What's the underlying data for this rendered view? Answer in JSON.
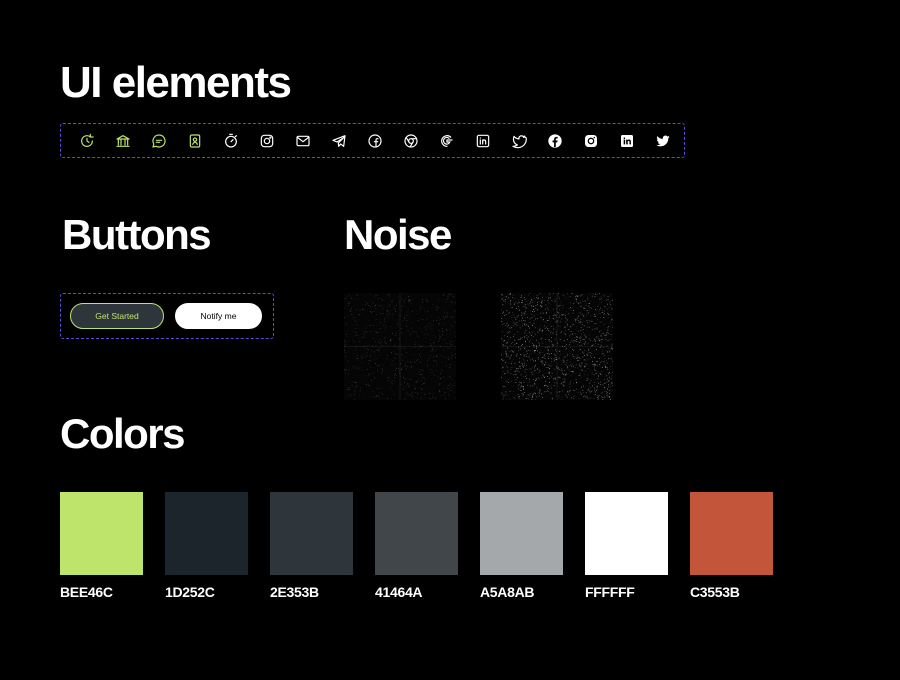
{
  "headings": {
    "ui_elements": "UI elements",
    "buttons": "Buttons",
    "noise": "Noise",
    "colors": "Colors"
  },
  "icons": [
    {
      "name": "refresh-clock-icon",
      "color": "#BEE46C"
    },
    {
      "name": "bank-icon",
      "color": "#BEE46C"
    },
    {
      "name": "chat-bubble-icon",
      "color": "#BEE46C"
    },
    {
      "name": "contact-card-icon",
      "color": "#BEE46C"
    },
    {
      "name": "stopwatch-icon",
      "color": "#FFFFFF"
    },
    {
      "name": "instagram-outline-icon",
      "color": "#FFFFFF"
    },
    {
      "name": "mail-icon",
      "color": "#FFFFFF"
    },
    {
      "name": "telegram-icon",
      "color": "#FFFFFF"
    },
    {
      "name": "facebook-outline-icon",
      "color": "#FFFFFF"
    },
    {
      "name": "chrome-icon",
      "color": "#FFFFFF"
    },
    {
      "name": "google-icon",
      "color": "#FFFFFF"
    },
    {
      "name": "linkedin-outline-icon",
      "color": "#FFFFFF"
    },
    {
      "name": "twitter-outline-icon",
      "color": "#FFFFFF"
    },
    {
      "name": "facebook-filled-icon",
      "color": "#FFFFFF"
    },
    {
      "name": "instagram-filled-icon",
      "color": "#FFFFFF"
    },
    {
      "name": "linkedin-filled-icon",
      "color": "#FFFFFF"
    },
    {
      "name": "twitter-filled-icon",
      "color": "#FFFFFF"
    }
  ],
  "buttons": {
    "get_started": "Get Started",
    "notify_me": "Notify me"
  },
  "colors": [
    {
      "label": "BEE46C",
      "hex": "#BEE46C"
    },
    {
      "label": "1D252C",
      "hex": "#1D252C"
    },
    {
      "label": "2E353B",
      "hex": "#2E353B"
    },
    {
      "label": "41464A",
      "hex": "#41464A"
    },
    {
      "label": "A5A8AB",
      "hex": "#A5A8AB"
    },
    {
      "label": "FFFFFF",
      "hex": "#FFFFFF"
    },
    {
      "label": "C3553B",
      "hex": "#C3553B"
    }
  ],
  "accent": "#BEE46C",
  "dashed_border": "#5B4BD6"
}
